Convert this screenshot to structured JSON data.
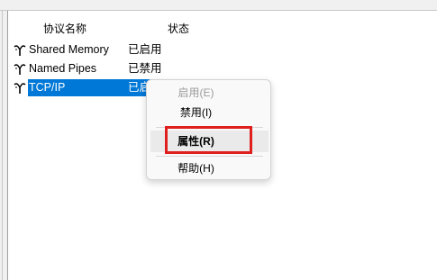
{
  "columns": {
    "name": "协议名称",
    "status": "状态"
  },
  "protocols": [
    {
      "name": "Shared Memory",
      "status": "已启用"
    },
    {
      "name": "Named Pipes",
      "status": "已禁用"
    },
    {
      "name": "TCP/IP",
      "status": "已启"
    }
  ],
  "context_menu": {
    "enable": "启用(E)",
    "disable": "禁用(I)",
    "properties": "属性(R)",
    "help": "帮助(H)"
  },
  "colors": {
    "selection": "#0078d7",
    "highlight_box": "#e01f1f"
  },
  "icons": {
    "protocol": "network-protocol-icon"
  }
}
